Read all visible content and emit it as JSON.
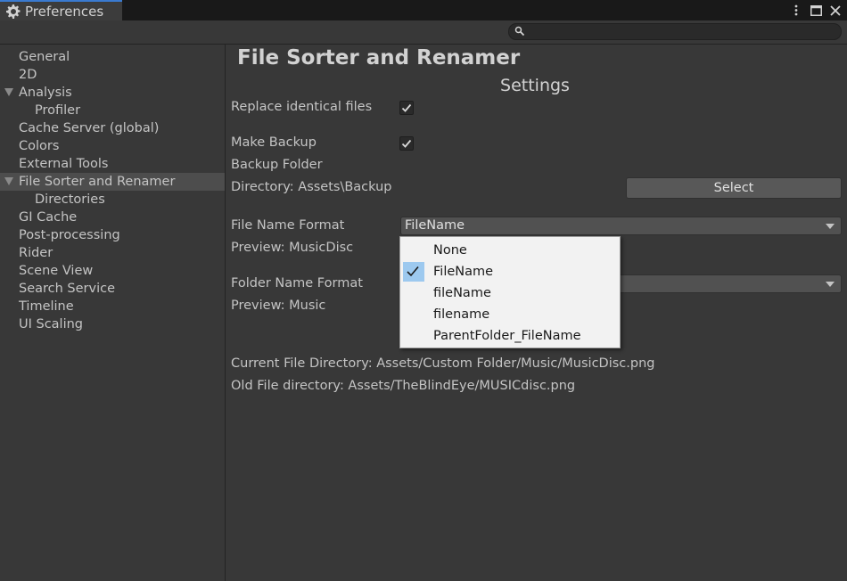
{
  "window": {
    "tab_title": "Preferences",
    "tab_icon": "gear-icon",
    "controls": [
      "kebab-menu-icon",
      "maximize-icon",
      "close-icon"
    ]
  },
  "search": {
    "value": "",
    "placeholder": ""
  },
  "sidebar": {
    "items": [
      {
        "label": "General"
      },
      {
        "label": "2D"
      },
      {
        "label": "Analysis"
      },
      {
        "label": "Profiler"
      },
      {
        "label": "Cache Server (global)"
      },
      {
        "label": "Colors"
      },
      {
        "label": "External Tools"
      },
      {
        "label": "File Sorter and Renamer"
      },
      {
        "label": "Directories"
      },
      {
        "label": "GI Cache"
      },
      {
        "label": "Post-processing"
      },
      {
        "label": "Rider"
      },
      {
        "label": "Scene View"
      },
      {
        "label": "Search Service"
      },
      {
        "label": "Timeline"
      },
      {
        "label": "UI Scaling"
      }
    ],
    "selected": "File Sorter and Renamer"
  },
  "main": {
    "title": "File Sorter and Renamer",
    "section_title": "Settings",
    "replace_identical_label": "Replace identical files",
    "replace_identical_checked": true,
    "make_backup_label": "Make Backup",
    "make_backup_checked": true,
    "backup_folder_label": "Backup Folder",
    "directory_label": "Directory: Assets\\Backup",
    "select_button": "Select",
    "file_name_format_label": "File Name Format",
    "file_name_format_value": "FileName",
    "preview_file_label": "Preview: MusicDisc",
    "folder_name_format_label": "Folder Name Format",
    "folder_name_format_value": "",
    "preview_folder_label": "Preview: Music",
    "current_dir": "Current File Directory: Assets/Custom Folder/Music/MusicDisc.png",
    "old_dir": "Old File directory: Assets/TheBlindEye/MUSICdisc.png"
  },
  "popup_menu": {
    "items": [
      {
        "label": "None",
        "checked": false
      },
      {
        "label": "FileName",
        "checked": true
      },
      {
        "label": "fileName",
        "checked": false
      },
      {
        "label": "filename",
        "checked": false
      },
      {
        "label": "ParentFolder_FileName",
        "checked": false
      }
    ]
  },
  "colors": {
    "background": "#383838",
    "tab_accent": "#3a7ad0",
    "selection": "#4d4d4d",
    "menu_check_highlight": "#9dc9ef"
  }
}
